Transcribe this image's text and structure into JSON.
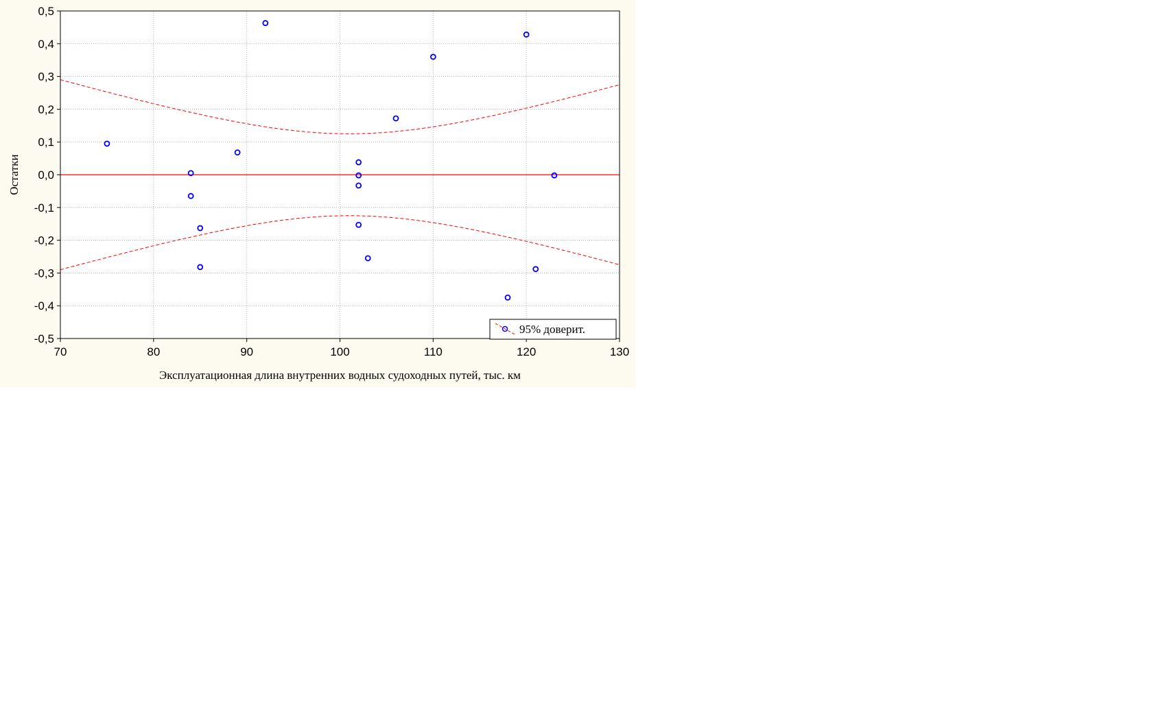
{
  "chart_data": {
    "type": "scatter",
    "title": "",
    "xlabel": "Эксплуатационная длина внутренних водных судоходных путей, тыс. км",
    "ylabel": "Остатки",
    "xlim": [
      70,
      130
    ],
    "ylim": [
      -0.5,
      0.5
    ],
    "x_ticks": [
      70,
      80,
      90,
      100,
      110,
      120,
      130
    ],
    "x_tick_labels": [
      "70",
      "80",
      "90",
      "100",
      "110",
      "120",
      "130"
    ],
    "y_ticks": [
      0.5,
      0.4,
      0.3,
      0.2,
      0.1,
      0.0,
      -0.1,
      -0.2,
      -0.3,
      -0.4,
      -0.5
    ],
    "y_tick_labels": [
      "0,5",
      "0,4",
      "0,3",
      "0,2",
      "0,1",
      "0,0",
      "-0,1",
      "-0,2",
      "-0,3",
      "-0,4",
      "-0,5"
    ],
    "grid": true,
    "legend": {
      "position": "bottom-right",
      "label": "95% доверит."
    },
    "points": [
      {
        "x": 75,
        "y": 0.095
      },
      {
        "x": 84,
        "y": 0.005
      },
      {
        "x": 84,
        "y": -0.065
      },
      {
        "x": 85,
        "y": -0.163
      },
      {
        "x": 85,
        "y": -0.282
      },
      {
        "x": 89,
        "y": 0.068
      },
      {
        "x": 92,
        "y": 0.463
      },
      {
        "x": 102,
        "y": 0.038
      },
      {
        "x": 102,
        "y": -0.002
      },
      {
        "x": 102,
        "y": -0.033
      },
      {
        "x": 102,
        "y": -0.153
      },
      {
        "x": 103,
        "y": -0.255
      },
      {
        "x": 106,
        "y": 0.172
      },
      {
        "x": 110,
        "y": 0.36
      },
      {
        "x": 118,
        "y": -0.375
      },
      {
        "x": 120,
        "y": 0.428
      },
      {
        "x": 121,
        "y": -0.288
      },
      {
        "x": 123,
        "y": -0.002
      }
    ],
    "zero_line": 0.0,
    "confidence_band": {
      "x_center": 101,
      "min_half_width": 0.125,
      "edge_x": 70,
      "edge_half_width": 0.29
    },
    "colors": {
      "points": "#0000ff",
      "fit_line": "#ff0000",
      "band": "#ff0000",
      "grid": "#b0b0b0",
      "background": "#fdfaf0"
    }
  }
}
